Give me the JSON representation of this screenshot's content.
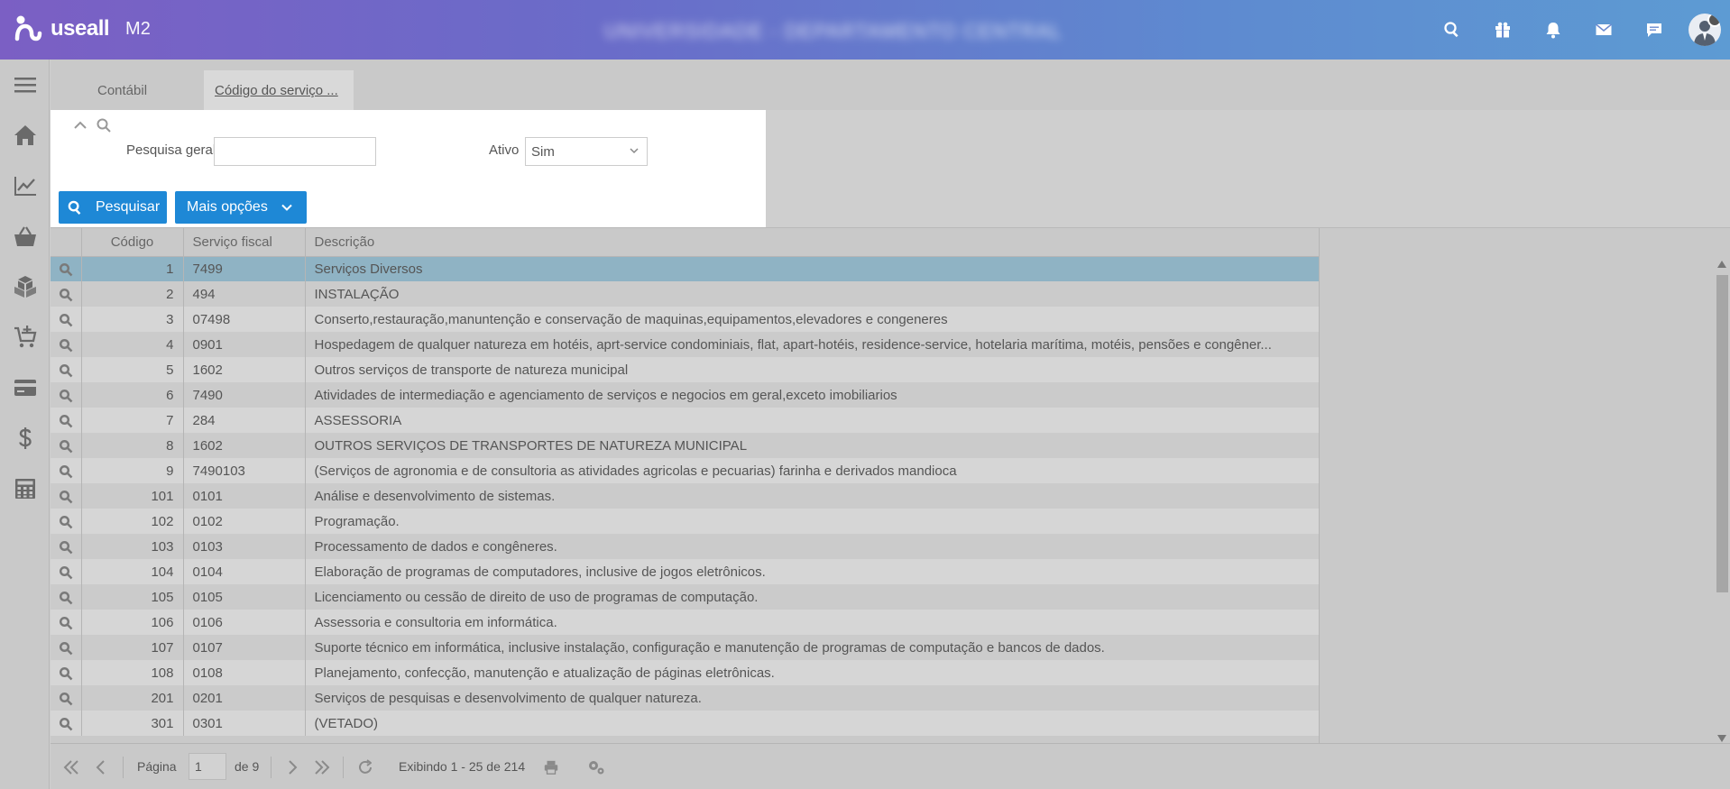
{
  "app": {
    "brand": "useall",
    "version": "M2",
    "company": "UNIVERSIDADE - DEPARTAMENTO CENTRAL"
  },
  "top_icons": [
    "search-icon",
    "gift-icon",
    "bell-icon",
    "mail-icon",
    "chat-icon",
    "user-avatar"
  ],
  "sidebar": {
    "items": [
      "menu-icon",
      "home-icon",
      "chart-icon",
      "basket-icon",
      "boxes-icon",
      "cart-add-icon",
      "credit-card-icon",
      "dollar-icon",
      "calculator-icon"
    ]
  },
  "tabs": [
    {
      "label": "Contábil",
      "active": false
    },
    {
      "label": "Código do serviço ...",
      "active": true
    }
  ],
  "filter": {
    "search_label": "Pesquisa geral",
    "search_value": "",
    "active_label": "Ativo",
    "active_value": "Sim",
    "search_button": "Pesquisar",
    "more_button": "Mais opções"
  },
  "grid": {
    "columns": [
      "Código",
      "Serviço fiscal",
      "Descrição"
    ],
    "rows": [
      {
        "code": "1",
        "fiscal": "7499",
        "desc": "Serviços Diversos",
        "selected": true
      },
      {
        "code": "2",
        "fiscal": "494",
        "desc": "INSTALAÇÃO"
      },
      {
        "code": "3",
        "fiscal": "07498",
        "desc": "Conserto,restauração,manuntenção e conservação de maquinas,equipamentos,elevadores e congeneres"
      },
      {
        "code": "4",
        "fiscal": "0901",
        "desc": "Hospedagem de qualquer natureza em hotéis, aprt-service condominiais, flat, apart-hotéis, residence-service, hotelaria marítima, motéis, pensões e congêner..."
      },
      {
        "code": "5",
        "fiscal": "1602",
        "desc": "Outros serviços de transporte de natureza municipal"
      },
      {
        "code": "6",
        "fiscal": "7490",
        "desc": "Atividades de intermediação e agenciamento de serviços e negocios em geral,exceto imobiliarios"
      },
      {
        "code": "7",
        "fiscal": "284",
        "desc": "ASSESSORIA"
      },
      {
        "code": "8",
        "fiscal": "1602",
        "desc": "OUTROS SERVIÇOS DE TRANSPORTES DE NATUREZA MUNICIPAL"
      },
      {
        "code": "9",
        "fiscal": "7490103",
        "desc": "(Serviços de agronomia e de consultoria as atividades agricolas e pecuarias) farinha e derivados mandioca"
      },
      {
        "code": "101",
        "fiscal": "0101",
        "desc": "Análise e desenvolvimento de sistemas."
      },
      {
        "code": "102",
        "fiscal": "0102",
        "desc": "Programação."
      },
      {
        "code": "103",
        "fiscal": "0103",
        "desc": "Processamento de dados e congêneres."
      },
      {
        "code": "104",
        "fiscal": "0104",
        "desc": "Elaboração de programas de computadores, inclusive de jogos eletrônicos."
      },
      {
        "code": "105",
        "fiscal": "0105",
        "desc": "Licenciamento ou cessão de direito de uso de programas de computação."
      },
      {
        "code": "106",
        "fiscal": "0106",
        "desc": "Assessoria e consultoria em informática."
      },
      {
        "code": "107",
        "fiscal": "0107",
        "desc": "Suporte técnico em informática, inclusive instalação, configuração e manutenção de programas de computação e bancos de dados."
      },
      {
        "code": "108",
        "fiscal": "0108",
        "desc": "Planejamento, confecção, manutenção e atualização de páginas eletrônicas."
      },
      {
        "code": "201",
        "fiscal": "0201",
        "desc": "Serviços de pesquisas e desenvolvimento de qualquer natureza."
      },
      {
        "code": "301",
        "fiscal": "0301",
        "desc": "(VETADO)"
      }
    ]
  },
  "pager": {
    "page_label": "Página",
    "page_value": "1",
    "of_label": "de 9",
    "summary": "Exibindo 1 - 25 de 214"
  },
  "colors": {
    "accent": "#1e88d6",
    "selected_row": "#8fb3c4",
    "topbar_start": "#7b5fc4",
    "topbar_end": "#5d9bd3"
  }
}
